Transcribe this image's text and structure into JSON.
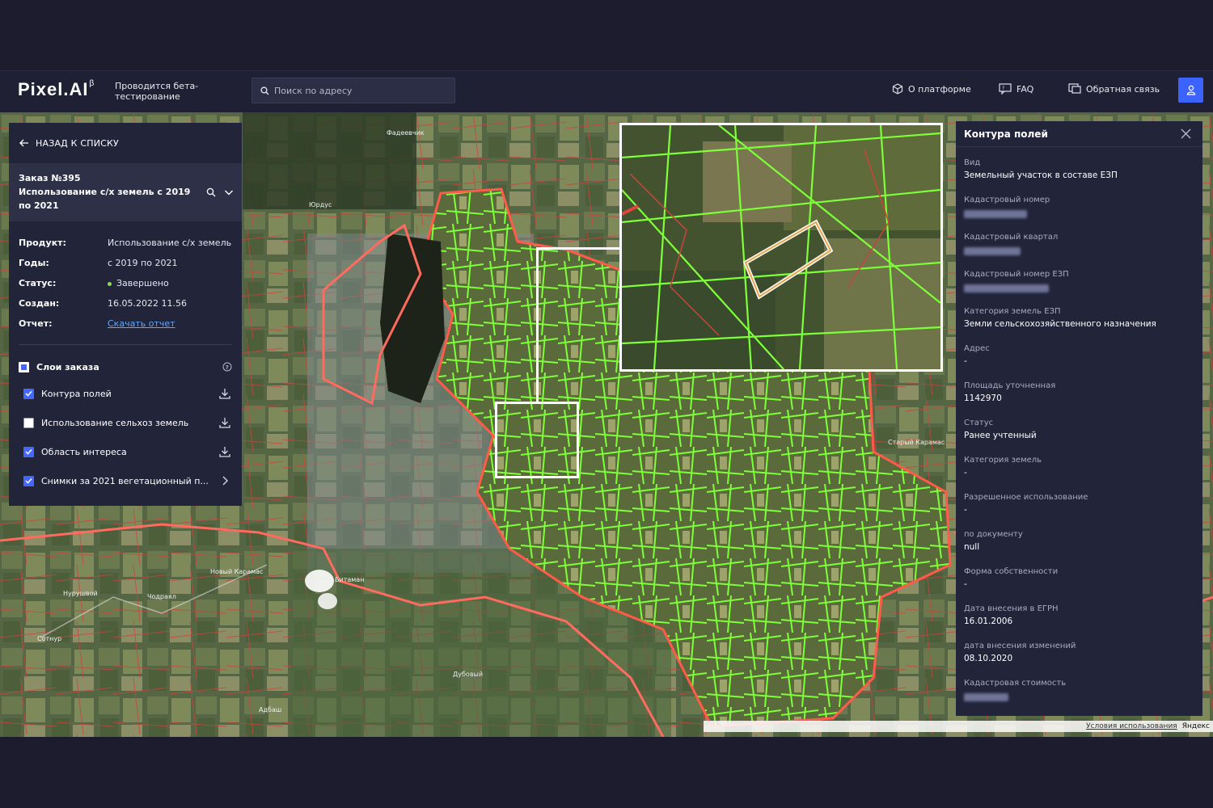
{
  "header": {
    "logo": "Pixel.AI",
    "logo_sup": "β",
    "beta_note": "Проводится бета-тестирование",
    "search_placeholder": "Поиск по адресу",
    "nav": {
      "about": "О платформе",
      "faq": "FAQ",
      "feedback": "Обратная связь"
    }
  },
  "left_panel": {
    "back": "НАЗАД К СПИСКУ",
    "order_number": "Заказ №395",
    "order_title": "Использование с/х земель с 2019 по 2021",
    "info": [
      {
        "key": "Продукт:",
        "value": "Использование с/х земель"
      },
      {
        "key": "Годы:",
        "value": "с 2019 по 2021"
      },
      {
        "key": "Статус:",
        "value": "Завершено"
      },
      {
        "key": "Создан:",
        "value": "16.05.2022 11.56"
      },
      {
        "key": "Отчет:",
        "value": "Скачать отчет"
      }
    ],
    "layers_title": "Слои заказа",
    "layers": [
      {
        "label": "Контура полей",
        "checked": true
      },
      {
        "label": "Использование сельхоз земель",
        "checked": false
      },
      {
        "label": "Область интереса",
        "checked": true
      },
      {
        "label": "Снимки за 2021 вегетационный п...",
        "checked": true
      }
    ]
  },
  "right_panel": {
    "title": "Контура полей",
    "attributes": [
      {
        "key": "Вид",
        "value": "Земельный участок в составе ЕЗП"
      },
      {
        "key": "Кадастровый номер",
        "value": ""
      },
      {
        "key": "Кадастровый квартал",
        "value": ""
      },
      {
        "key": "Кадастровый номер ЕЗП",
        "value": ""
      },
      {
        "key": "Категория земель ЕЗП",
        "value": "Земли сельскохозяйственного назначения"
      },
      {
        "key": "Адрес",
        "value": "-"
      },
      {
        "key": "Площадь уточненная",
        "value": "1142970"
      },
      {
        "key": "Статус",
        "value": "Ранее учтенный"
      },
      {
        "key": "Категория земель",
        "value": "-"
      },
      {
        "key": "Разрешенное использование",
        "value": "-"
      },
      {
        "key": "по документу",
        "value": "null"
      },
      {
        "key": "Форма собственности",
        "value": "-"
      },
      {
        "key": "Дата внесения в ЕГРН",
        "value": "16.01.2006"
      },
      {
        "key": "дата внесения изменений",
        "value": "08.10.2020"
      },
      {
        "key": "Кадастровая стоимость",
        "value": ""
      }
    ]
  },
  "map": {
    "place_labels": [
      "Фадеевчик",
      "Юрдус",
      "Новый Карамас",
      "Нурушвой",
      "Чодраял",
      "Сотнур",
      "Битаман",
      "Дубовый",
      "Адбаш",
      "Старый Карамас"
    ],
    "terms_link": "Условия использования",
    "provider": "Яндекс"
  },
  "colors": {
    "accent": "#3d63ff",
    "field_contour": "#7dff3a",
    "cadastral_line": "#e0463e",
    "panel_bg": "#22243a",
    "link": "#5fa8ff"
  }
}
